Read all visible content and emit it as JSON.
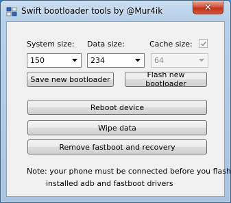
{
  "window": {
    "title": "Swift bootloader tools by @Mur4ik",
    "close_label": "✕"
  },
  "form": {
    "system_size_label": "System size:",
    "system_size_value": "150",
    "data_size_label": "Data size:",
    "data_size_value": "234",
    "cache_size_label": "Cache size:",
    "cache_size_value": "64",
    "cache_checked": true
  },
  "buttons": {
    "save_bootloader": "Save new bootloader",
    "flash_bootloader": "Flash new bootloader",
    "reboot": "Reboot device",
    "wipe": "Wipe data",
    "remove": "Remove fastboot and recovery"
  },
  "note": {
    "line1": "Note: your phone must be connected before you flash,",
    "line2": "installed adb and fastboot drivers"
  }
}
